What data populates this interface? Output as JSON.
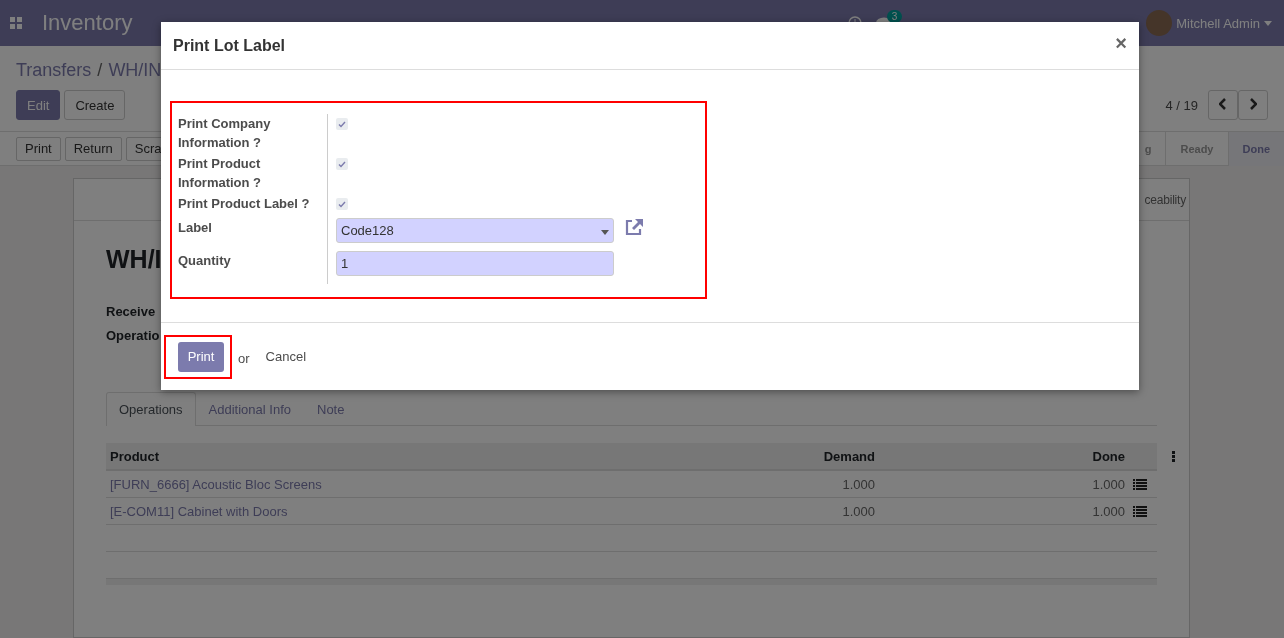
{
  "navbar": {
    "app_title": "Inventory",
    "message_count": "3",
    "user": "Mitchell Admin"
  },
  "control_panel": {
    "breadcrumbs": [
      "Transfers",
      "WH/IN"
    ],
    "breadcrumb_separator": "/",
    "buttons": [
      {
        "label": "Edit",
        "kind": "primary"
      },
      {
        "label": "Create",
        "kind": "secondary"
      }
    ],
    "pager": "4 / 19",
    "action_buttons": [
      "Print",
      "Return",
      "Scra"
    ],
    "stages": [
      {
        "label": "g",
        "selected": false
      },
      {
        "label": "Ready",
        "selected": false
      },
      {
        "label": "Done",
        "selected": true
      }
    ]
  },
  "sheet": {
    "smart_button": "ceability",
    "title": "WH/I",
    "field_labels": [
      "Receive",
      "Operatio"
    ],
    "tabs": [
      {
        "label": "Operations",
        "selected": true
      },
      {
        "label": "Additional Info",
        "selected": false
      },
      {
        "label": "Note",
        "selected": false
      }
    ],
    "table": {
      "columns": [
        "Product",
        "Demand",
        "Done"
      ],
      "rows": [
        {
          "product": "[FURN_6666] Acoustic Bloc Screens",
          "demand": "1.000",
          "done": "1.000"
        },
        {
          "product": "[E-COM11] Cabinet with Doors",
          "demand": "1.000",
          "done": "1.000"
        }
      ]
    }
  },
  "dialog": {
    "title": "Print Lot Label",
    "close": "×",
    "fields": [
      {
        "kind": "checkbox",
        "label": "Print Company Information ?",
        "checked": true
      },
      {
        "kind": "checkbox",
        "label": "Print Product Information ?",
        "checked": true
      },
      {
        "kind": "checkbox",
        "label": "Print Product Label ?",
        "checked": true
      },
      {
        "kind": "select",
        "label": "Label",
        "value": "Code128"
      },
      {
        "kind": "input",
        "label": "Quantity",
        "value": "1"
      }
    ],
    "primary_button": "Print",
    "or_text": "or",
    "cancel": "Cancel"
  }
}
